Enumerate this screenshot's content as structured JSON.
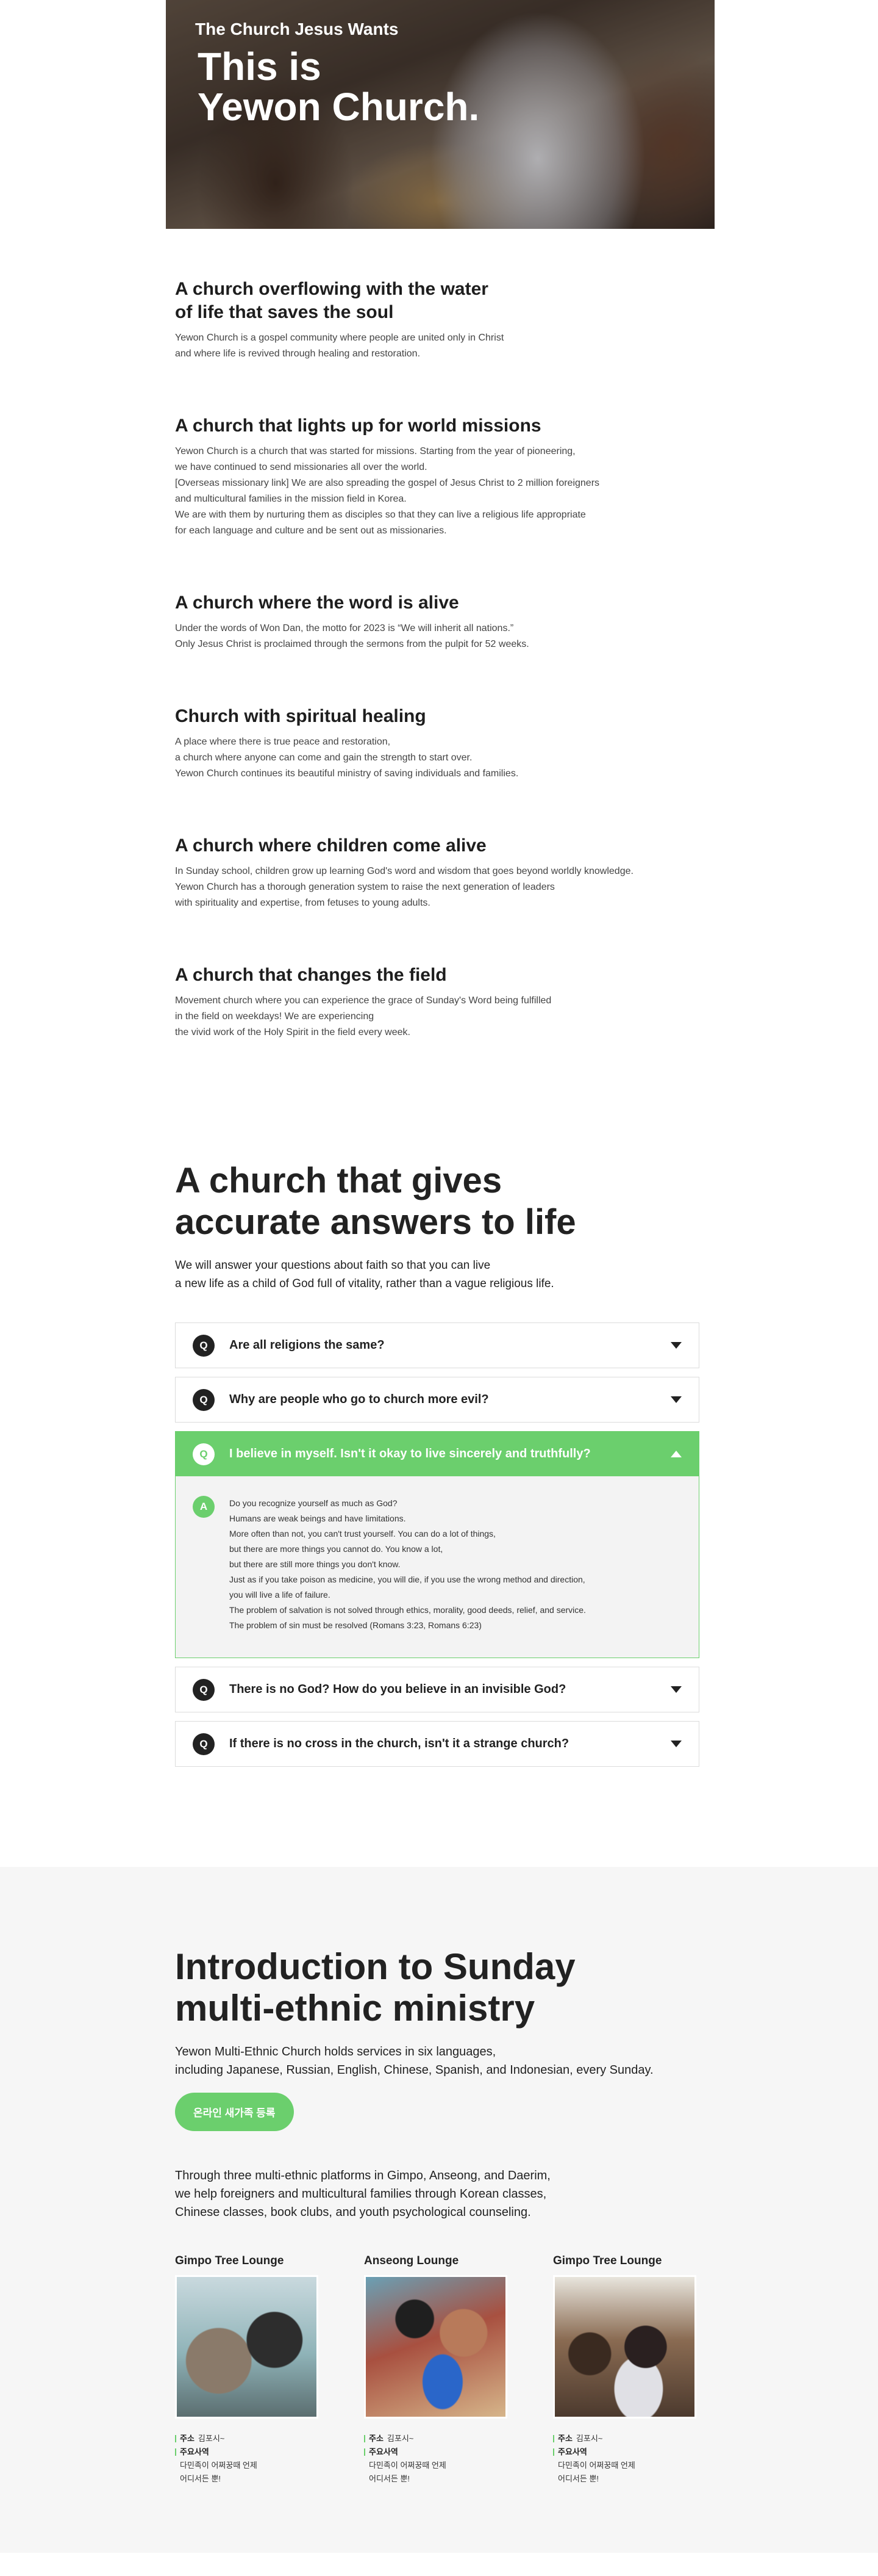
{
  "hero": {
    "subtitle": "The Church Jesus Wants",
    "title_line1": "This is",
    "title_line2": "Yewon Church."
  },
  "features": [
    {
      "title": "A church overflowing with the water\nof life that saves the soul",
      "text": "Yewon Church is a gospel community where people are united only in Christ\nand where life is revived through healing and restoration."
    },
    {
      "title": "A church that lights up for world missions",
      "text": "Yewon Church is a church that was started for missions. Starting from the year of pioneering,\nwe have continued to send missionaries all over the world.\n[Overseas missionary link] We are also spreading the gospel of Jesus Christ to 2 million foreigners\nand multicultural families in the mission field in Korea.\nWe are with them by nurturing them as disciples so that they can live a religious life appropriate\nfor each language and culture and be sent out as missionaries."
    },
    {
      "title": "A church where the word is alive",
      "text": "Under the words of Won Dan, the motto for 2023 is “We will inherit all nations.”\nOnly Jesus Christ is proclaimed through the sermons from the pulpit for 52 weeks."
    },
    {
      "title": "Church with spiritual healing",
      "text": "A place where there is true peace and restoration,\na church where anyone can come and gain the strength to start over.\nYewon Church continues its beautiful ministry of saving individuals and families."
    },
    {
      "title": "A church where children come alive",
      "text": "In Sunday school, children grow up learning God's word and wisdom that goes beyond worldly knowledge.\nYewon Church has a thorough generation system to raise the next generation of leaders\nwith spirituality and expertise, from fetuses to young adults."
    },
    {
      "title": "A church that changes the field",
      "text": "Movement church where you can experience the grace of Sunday's Word being fulfilled\nin the field on weekdays! We are experiencing\nthe vivid work of the Holy Spirit in the field every week."
    }
  ],
  "faq": {
    "title": "A church that gives\naccurate answers to life",
    "intro": "We will answer your questions about faith so that you can live\na new life as a child of God full of vitality, rather than a vague religious life.",
    "q_badge": "Q",
    "a_badge": "A",
    "items": [
      {
        "question": "Are all religions the same?"
      },
      {
        "question": "Why are people who go to church more evil?"
      },
      {
        "question": "I believe in myself. Isn't it okay to live sincerely and truthfully?",
        "answer": "Do you recognize yourself as much as God?\nHumans are weak beings and have limitations.\nMore often than not, you can't trust yourself. You can do a lot of things,\nbut there are more things you cannot do. You know a lot,\nbut there are still more things you don't know.\nJust as if you take poison as medicine, you will die, if you use the wrong method and direction,\nyou will live a life of failure.\nThe problem of salvation is not solved through ethics, morality, good deeds, relief, and service.\nThe problem of sin must be resolved (Romans 3:23, Romans 6:23)"
      },
      {
        "question": "There is no God? How do you believe in an invisible God?"
      },
      {
        "question": "If there is no cross in the church, isn't it a strange church?"
      }
    ]
  },
  "ministry": {
    "title": "Introduction to Sunday\nmulti-ethnic ministry",
    "intro": "Yewon Multi-Ethnic Church holds services in six languages,\nincluding Japanese, Russian, English, Chinese, Spanish, and Indonesian, every Sunday.",
    "button": "온라인 새가족 등록",
    "desc": "Through three multi-ethnic platforms in Gimpo, Anseong, and Daerim,\nwe help foreigners and multicultural families through Korean classes,\nChinese classes, book clubs, and youth psychological counseling.",
    "lounges": [
      {
        "name": "Gimpo Tree Lounge",
        "addr_label": "주소",
        "addr": "김포시~",
        "biz_label": "주요사역",
        "biz1": "다민족이 어쩌꿍때 언제",
        "biz2": "어디서든 뿐!"
      },
      {
        "name": "Anseong Lounge",
        "addr_label": "주소",
        "addr": "김포시~",
        "biz_label": "주요사역",
        "biz1": "다민족이 어쩌꿍때 언제",
        "biz2": "어디서든 뿐!"
      },
      {
        "name": "Gimpo Tree Lounge",
        "addr_label": "주소",
        "addr": "김포시~",
        "biz_label": "주요사역",
        "biz1": "다민족이 어쩌꿍때 언제",
        "biz2": "어디서든 뿐!"
      }
    ]
  },
  "colors": {
    "accent": "#6bcf6d",
    "dark": "#222222",
    "panel": "#f3f3f3"
  }
}
